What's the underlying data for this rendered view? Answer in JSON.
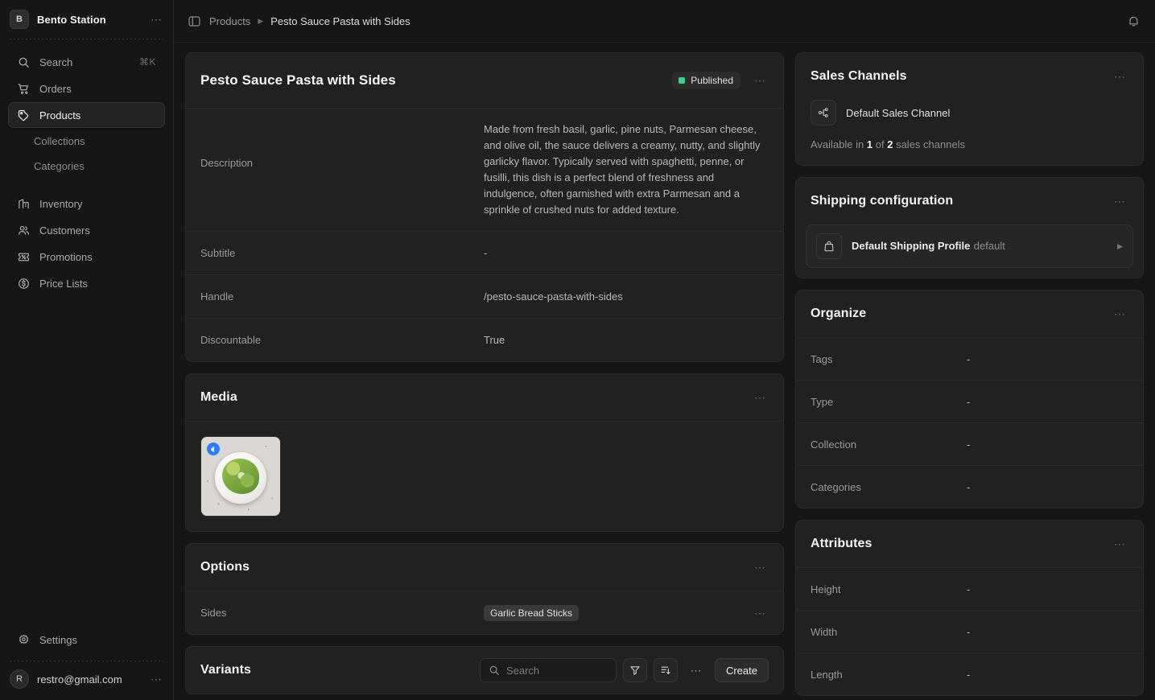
{
  "sidebar": {
    "org": {
      "initial": "B",
      "name": "Bento Station",
      "menu": "⋯"
    },
    "items": [
      {
        "label": "Search",
        "icon": "search-icon",
        "shortcut": "⌘K",
        "active": false
      },
      {
        "label": "Orders",
        "icon": "cart-icon",
        "shortcut": "",
        "active": false
      },
      {
        "label": "Products",
        "icon": "tag-icon",
        "shortcut": "",
        "active": true
      }
    ],
    "sub_items": [
      {
        "label": "Collections"
      },
      {
        "label": "Categories"
      }
    ],
    "items2": [
      {
        "label": "Inventory",
        "icon": "warehouse-icon"
      },
      {
        "label": "Customers",
        "icon": "users-icon"
      },
      {
        "label": "Promotions",
        "icon": "ticket-percent-icon"
      },
      {
        "label": "Price Lists",
        "icon": "dollar-circle-icon"
      }
    ],
    "settings": {
      "label": "Settings",
      "icon": "gear-icon"
    },
    "user": {
      "initial": "R",
      "email": "restro@gmail.com",
      "menu": "⋯"
    }
  },
  "topbar": {
    "panel_icon": "sidebar-toggle-icon",
    "breadcrumb_root": "Products",
    "breadcrumb_sep": "▶",
    "breadcrumb_current": "Pesto Sauce Pasta with Sides",
    "bell_icon": "bell-icon"
  },
  "product": {
    "title": "Pesto Sauce Pasta with Sides",
    "status": "Published",
    "status_color": "#3ecf8e",
    "menu": "⋯",
    "fields": [
      {
        "label": "Description",
        "value": "Made from fresh basil, garlic, pine nuts, Parmesan cheese, and olive oil, the sauce delivers a creamy, nutty, and slightly garlicky flavor. Typically served with spaghetti, penne, or fusilli, this dish is a perfect blend of freshness and indulgence, often garnished with extra Parmesan and a sprinkle of crushed nuts for added texture."
      },
      {
        "label": "Subtitle",
        "value": "-"
      },
      {
        "label": "Handle",
        "value": "/pesto-sauce-pasta-with-sides"
      },
      {
        "label": "Discountable",
        "value": "True"
      }
    ]
  },
  "media": {
    "title": "Media",
    "menu": "⋯",
    "thumb_alt": "pesto-pasta-bowl",
    "thumb_badge_icon": "primary-image-icon"
  },
  "options": {
    "title": "Options",
    "menu": "⋯",
    "rows": [
      {
        "label": "Sides",
        "values": [
          "Garlic Bread Sticks"
        ],
        "menu": "⋯"
      }
    ]
  },
  "variants": {
    "title": "Variants",
    "search_placeholder": "Search",
    "search_value": "",
    "filter_icon": "filter-icon",
    "sort_icon": "sort-icon",
    "menu": "⋯",
    "create_label": "Create"
  },
  "sales_channels": {
    "title": "Sales Channels",
    "menu": "⋯",
    "channel_icon": "channels-icon",
    "channel_name": "Default Sales Channel",
    "availability_prefix": "Available in",
    "available_count": "1",
    "availability_mid": "of",
    "total_count": "2",
    "availability_suffix": "sales channels"
  },
  "shipping": {
    "title": "Shipping configuration",
    "menu": "⋯",
    "profile_icon": "bag-icon",
    "profile_name": "Default Shipping Profile",
    "profile_sub": "default",
    "chevron": "▶"
  },
  "organize": {
    "title": "Organize",
    "menu": "⋯",
    "rows": [
      {
        "label": "Tags",
        "value": "-"
      },
      {
        "label": "Type",
        "value": "-"
      },
      {
        "label": "Collection",
        "value": "-"
      },
      {
        "label": "Categories",
        "value": "-"
      }
    ]
  },
  "attributes": {
    "title": "Attributes",
    "menu": "⋯",
    "rows": [
      {
        "label": "Height",
        "value": "-"
      },
      {
        "label": "Width",
        "value": "-"
      },
      {
        "label": "Length",
        "value": "-"
      }
    ]
  },
  "theme": {
    "page_bg": "#161616",
    "card_bg": "#212121",
    "border": "#2b2b2b",
    "accent_green": "#3ecf8e",
    "badge_blue": "#2f7bf6"
  }
}
